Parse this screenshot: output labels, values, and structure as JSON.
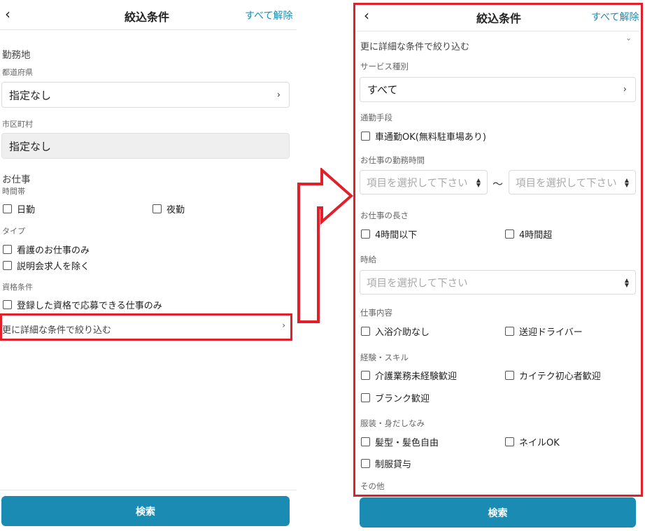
{
  "left": {
    "header": {
      "title": "絞込条件",
      "clear_all": "すべて解除",
      "back_icon": "chevron-left-icon"
    },
    "work_location": {
      "title": "勤務地",
      "prefecture_label": "都道府県",
      "prefecture_value": "指定なし",
      "city_label": "市区町村",
      "city_value": "指定なし"
    },
    "job": {
      "title": "お仕事",
      "time_label": "時間帯",
      "time_options": [
        "日勤",
        "夜勤"
      ],
      "type_label": "タイプ",
      "type_options": [
        "看護のお仕事のみ",
        "説明会求人を除く"
      ],
      "qual_label": "資格条件",
      "qual_options": [
        "登録した資格で応募できる仕事のみ"
      ]
    },
    "more_filters": "更に詳細な条件で絞り込む",
    "search_button": "検索"
  },
  "right": {
    "header": {
      "title": "絞込条件",
      "clear_all": "すべて解除",
      "back_icon": "chevron-left-icon"
    },
    "more_filters": "更に詳細な条件で絞り込む",
    "service_label": "サービス種別",
    "service_value": "すべて",
    "commute_label": "通勤手段",
    "commute_options": [
      "車通勤OK(無料駐車場あり)"
    ],
    "hours_label": "お仕事の勤務時間",
    "hours_from_placeholder": "項目を選択して下さい",
    "hours_separator": "〜",
    "hours_to_placeholder": "項目を選択して下さい",
    "length_label": "お仕事の長さ",
    "length_options": [
      "4時間以下",
      "4時間超"
    ],
    "wage_label": "時給",
    "wage_placeholder": "項目を選択して下さい",
    "content_label": "仕事内容",
    "content_options": [
      "入浴介助なし",
      "送迎ドライバー"
    ],
    "skill_label": "経験・スキル",
    "skill_options": [
      "介護業務未経験歓迎",
      "カイテク初心者歓迎",
      "ブランク歓迎"
    ],
    "dress_label": "服装・身だしなみ",
    "dress_options": [
      "髪型・髪色自由",
      "ネイルOK",
      "制服貸与"
    ],
    "other_label": "その他",
    "search_button": "検索"
  },
  "colors": {
    "accent": "#1a8bb3",
    "highlight": "#e0212b"
  }
}
